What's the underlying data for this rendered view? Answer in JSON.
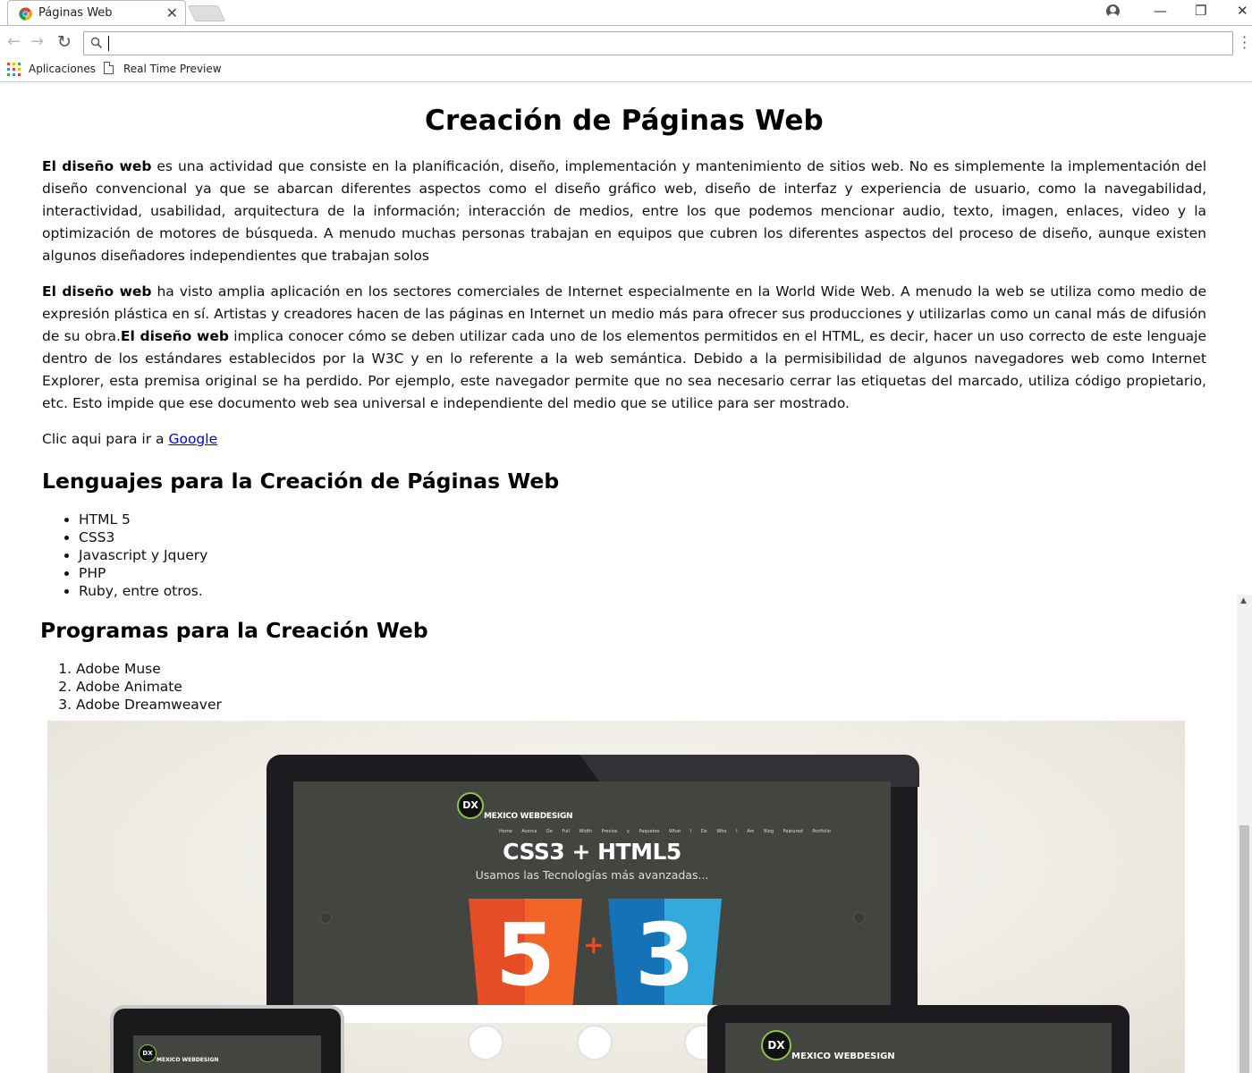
{
  "browser": {
    "tab_title": "Páginas Web",
    "tab_close": "✕",
    "address_value": "",
    "window_controls": {
      "minimize": "—",
      "restore": "❐",
      "close": "✕"
    },
    "bookmarks": [
      {
        "label": "Aplicaciones",
        "icon": "apps-grid-icon"
      },
      {
        "label": "Real Time Preview",
        "icon": "page-icon"
      }
    ]
  },
  "page": {
    "title": "Creación de Páginas Web",
    "p1": {
      "bold": "El diseño web",
      "text": " es una actividad que consiste en la planificación, diseño, implementación y mantenimiento de sitios web. No es simplemente la implementación del diseño convencional ya que se abarcan diferentes aspectos como el diseño gráfico web, diseño de interfaz y experiencia de usuario, como la navegabilidad, interactividad, usabilidad, arquitectura de la información; interacción de medios, entre los que podemos mencionar audio, texto, imagen, enlaces, video y la optimización de motores de búsqueda. A menudo muchas personas trabajan en equipos que cubren los diferentes aspectos del proceso de diseño, aunque existen algunos diseñadores independientes que trabajan solos"
    },
    "p2": {
      "bold1": "El diseño web",
      "text1": " ha visto amplia aplicación en los sectores comerciales de Internet especialmente en la World Wide Web. A menudo la web se utiliza como medio de expresión plástica en sí. Artistas y creadores hacen de las páginas en Internet un medio más para ofrecer sus producciones y utilizarlas como un canal más de difusión de su obra.",
      "bold2": "El diseño web",
      "text2": " implica conocer cómo se deben utilizar cada uno de los elementos permitidos en el HTML, es decir, hacer un uso correcto de este lenguaje dentro de los estándares establecidos por la W3C y en lo referente a la web semántica. Debido a la permisibilidad de algunos navegadores web como Internet Explorer, esta premisa original se ha perdido. Por ejemplo, este navegador permite que no sea necesario cerrar las etiquetas del marcado, utiliza código propietario, etc. Esto impide que ese documento web sea universal e independiente del medio que se utilice para ser mostrado."
    },
    "link_prefix": "Clic aqui para ir a ",
    "link_text": "Google",
    "languages_heading": "Lenguajes para la Creación de Páginas Web",
    "languages": [
      "HTML 5",
      "CSS3",
      "Javascript y Jquery",
      "PHP",
      "Ruby, entre otros."
    ],
    "programs_heading": "Programas para la Creación Web",
    "programs": [
      "Adobe Muse",
      "Adobe Animate",
      "Adobe Dreamweaver"
    ],
    "hero": {
      "logo_mark": "DX",
      "brand": "MEXICO WEBDESIGN",
      "nav": "Home Acerca De Full Width Precios y Paquetes What I Do Who I Am Blog Featured Portfolio",
      "headline": "CSS3 + HTML5",
      "subline": "Usamos las Tecnologías más avanzadas...",
      "html5_number": "5",
      "css3_number": "3",
      "plus": "+"
    }
  }
}
